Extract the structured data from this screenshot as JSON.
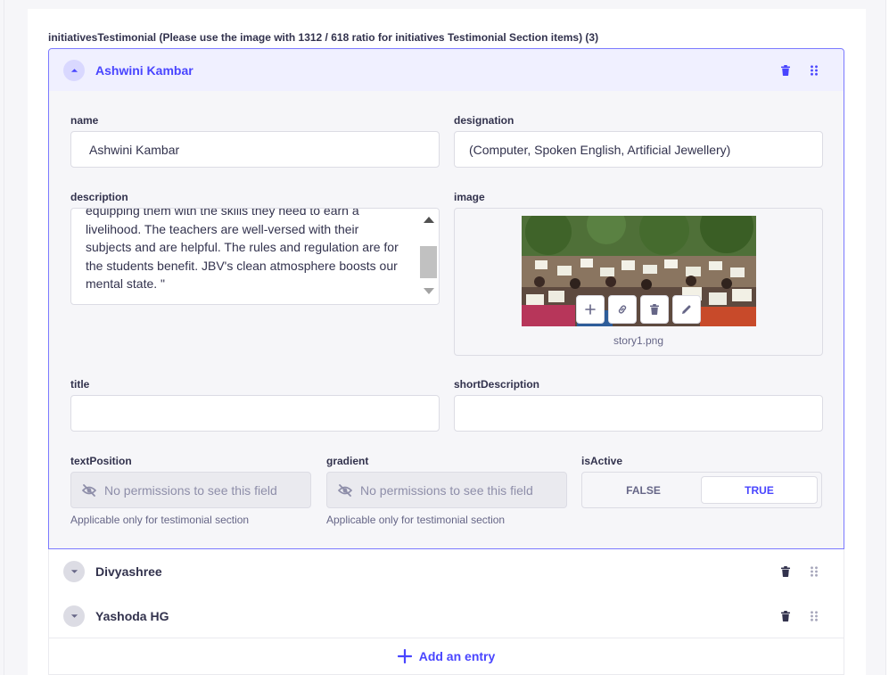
{
  "section": {
    "label": "initiativesTestimonial (Please use the image with 1312 / 618 ratio for initiatives Testimonial Section items) (3)"
  },
  "entries": [
    {
      "title": "Ashwini Kambar",
      "expanded": true
    },
    {
      "title": "Divyashree",
      "expanded": false
    },
    {
      "title": "Yashoda HG",
      "expanded": false
    }
  ],
  "form": {
    "name": {
      "label": "name",
      "value": "Ashwini Kambar"
    },
    "designation": {
      "label": "designation",
      "value": "(Computer, Spoken English, Artificial Jewellery)"
    },
    "description": {
      "label": "description",
      "value": "equipping them with the skills they need to earn a livelihood. The teachers are well-versed with their subjects and are helpful. The rules and regulation are for the students benefit. JBV's clean atmosphere boosts our mental state. \""
    },
    "image": {
      "label": "image",
      "filename": "story1.png"
    },
    "title": {
      "label": "title",
      "value": ""
    },
    "shortDescription": {
      "label": "shortDescription",
      "value": ""
    },
    "textPosition": {
      "label": "textPosition",
      "placeholder": "No permissions to see this field",
      "hint": "Applicable only for testimonial section"
    },
    "gradient": {
      "label": "gradient",
      "placeholder": "No permissions to see this field",
      "hint": "Applicable only for testimonial section"
    },
    "isActive": {
      "label": "isActive",
      "false_label": "FALSE",
      "true_label": "TRUE",
      "selected": "TRUE"
    }
  },
  "add_entry": {
    "label": "Add an entry"
  },
  "colors": {
    "primary": "#4945ff",
    "primary_light": "#f0f0ff",
    "border_active": "#7b79ff",
    "neutral_text": "#32324d",
    "muted_text": "#666687",
    "disabled_bg": "#eaeaef"
  },
  "icons": {
    "collapse": "chevron-up-icon",
    "expand": "chevron-down-icon",
    "delete": "trash-icon",
    "drag": "drag-handle-icon",
    "add": "plus-icon",
    "link": "link-icon",
    "edit": "pencil-icon",
    "hidden": "eye-striked-icon"
  }
}
